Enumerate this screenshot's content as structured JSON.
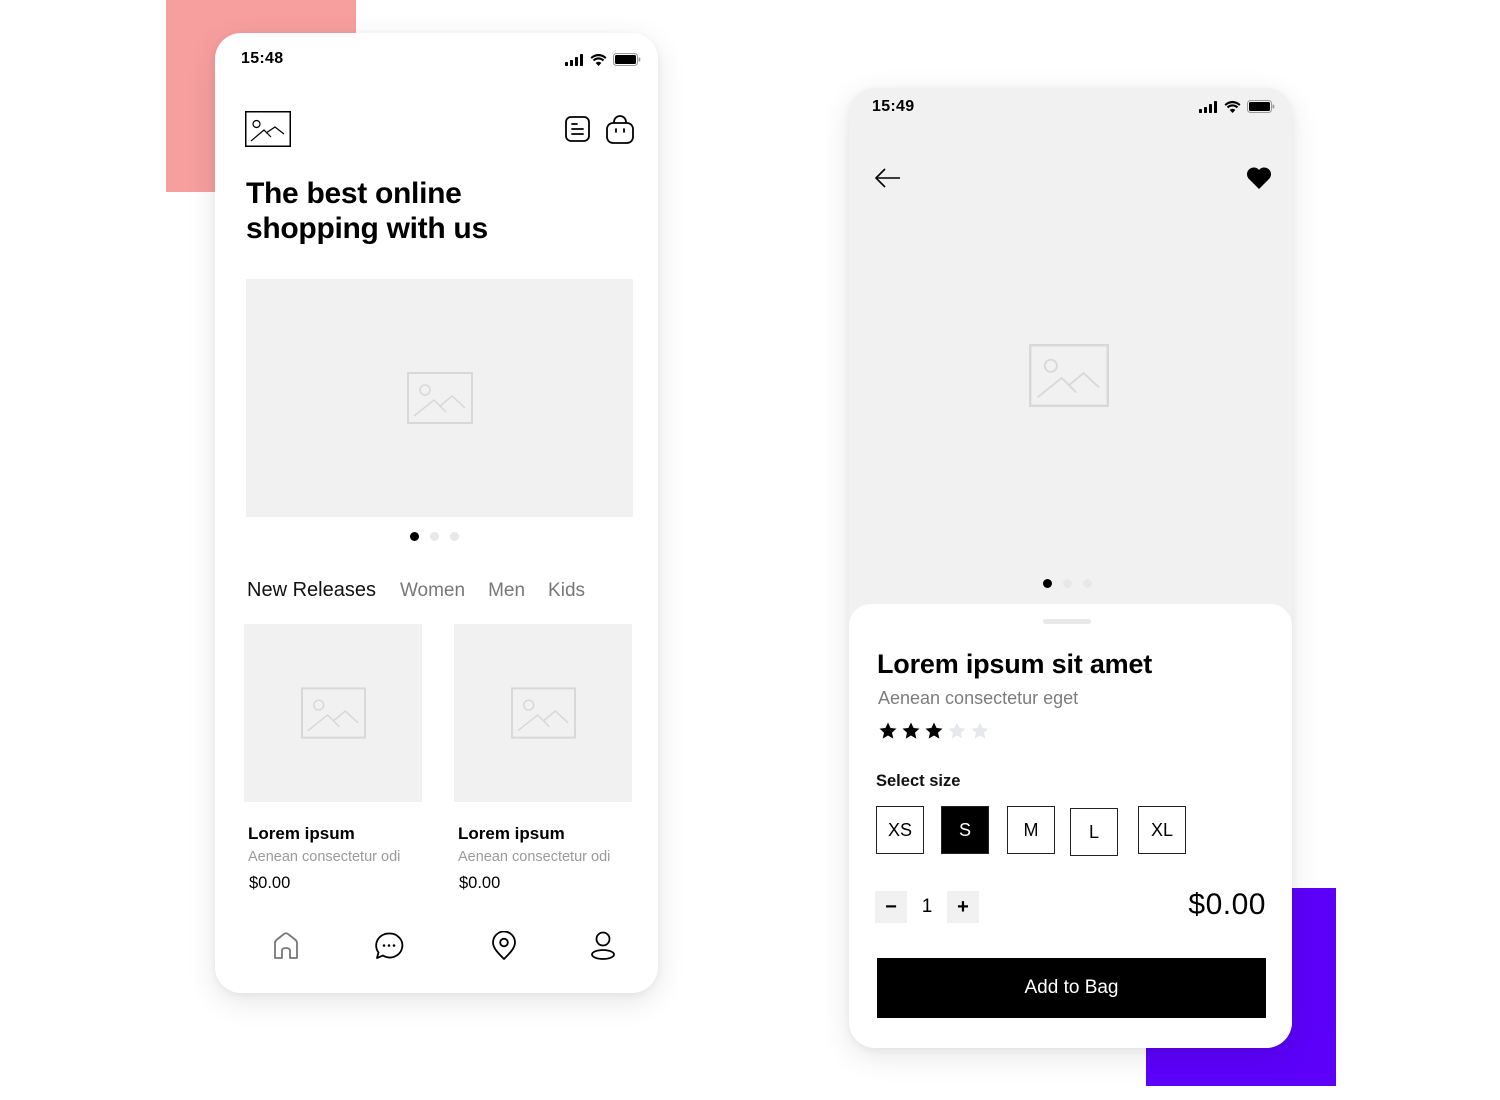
{
  "decor": {
    "accent_pink": "#f79f9f",
    "accent_purple": "#5c00fa"
  },
  "home_screen": {
    "status": {
      "time": "15:48"
    },
    "header": {
      "logo_icon": "image-placeholder-icon",
      "menu_icon": "list-icon",
      "bag_icon": "shopping-bag-icon"
    },
    "hero_title": "The best online shopping with us",
    "carousel": {
      "slides": 3,
      "active_index": 0
    },
    "tabs": [
      {
        "label": "New Releases",
        "active": true
      },
      {
        "label": "Women",
        "active": false
      },
      {
        "label": "Men",
        "active": false
      },
      {
        "label": "Kids",
        "active": false
      }
    ],
    "products": [
      {
        "name": "Lorem ipsum",
        "description": "Aenean consectetur odi",
        "price": "$0.00"
      },
      {
        "name": "Lorem ipsum",
        "description": "Aenean consectetur odi",
        "price": "$0.00"
      }
    ],
    "bottom_nav": [
      {
        "icon": "home-icon",
        "active": true
      },
      {
        "icon": "chat-icon",
        "active": false
      },
      {
        "icon": "location-pin-icon",
        "active": false
      },
      {
        "icon": "user-icon",
        "active": false
      }
    ]
  },
  "detail_screen": {
    "status": {
      "time": "15:49"
    },
    "carousel": {
      "slides": 3,
      "active_index": 0
    },
    "product": {
      "title": "Lorem ipsum sit amet",
      "subtitle": "Aenean consectetur eget",
      "rating": 3,
      "rating_max": 5
    },
    "size_label": "Select size",
    "sizes": [
      "XS",
      "S",
      "M",
      "L",
      "XL"
    ],
    "selected_size": "S",
    "quantity": "1",
    "qty_minus": "−",
    "qty_plus": "+",
    "price": "$0.00",
    "add_button_label": "Add to Bag"
  }
}
